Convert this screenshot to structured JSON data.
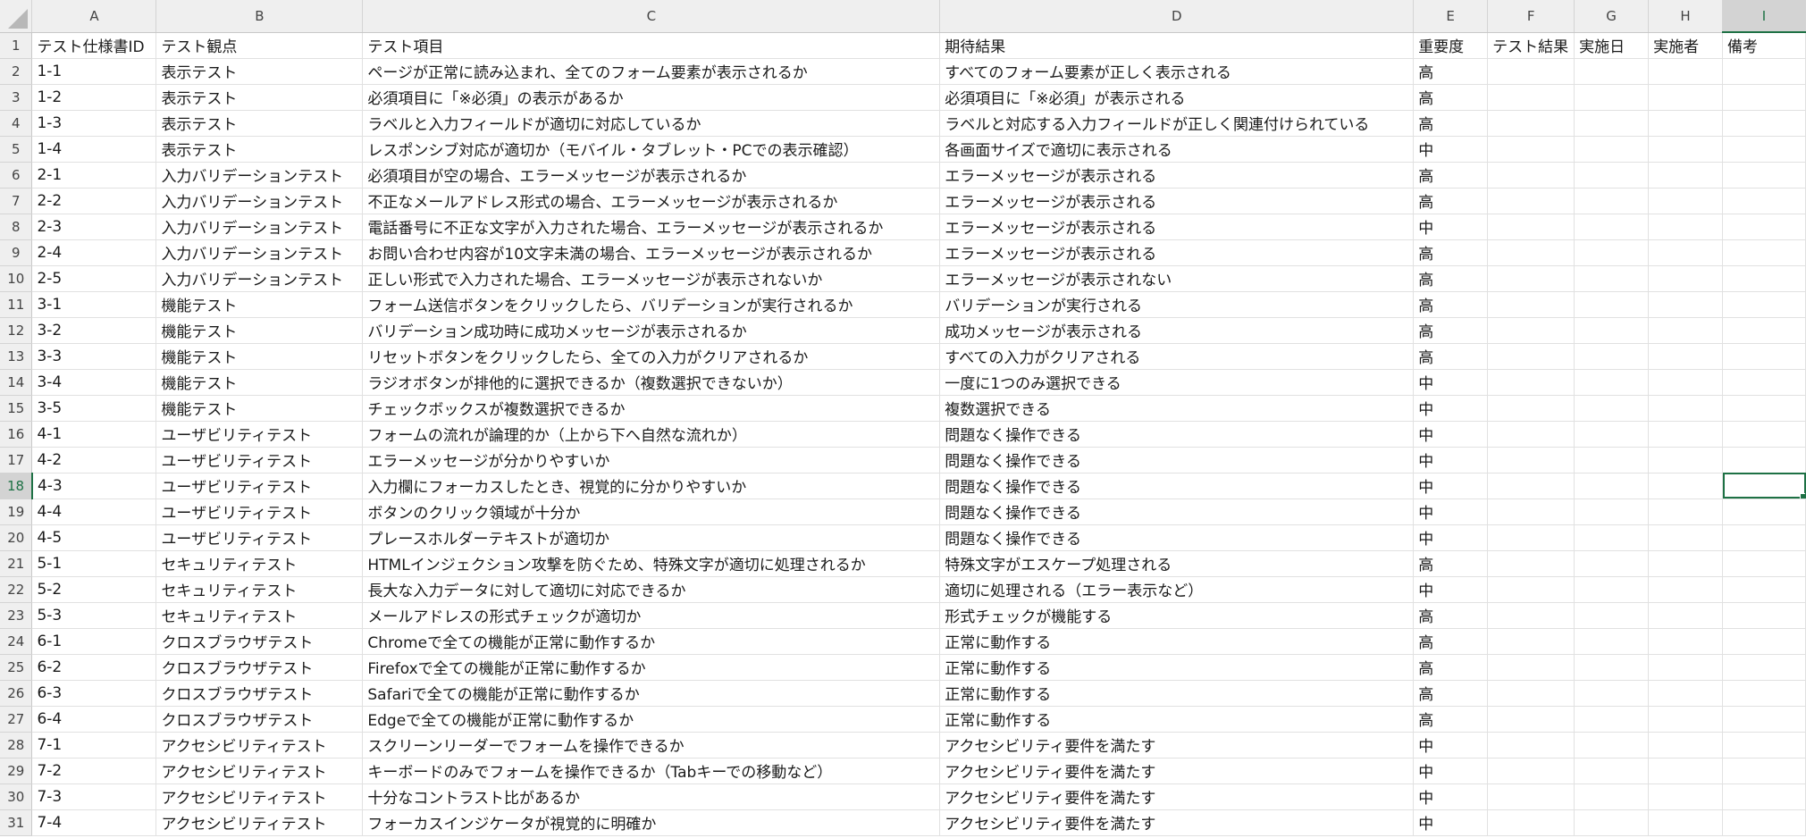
{
  "columns": [
    "A",
    "B",
    "C",
    "D",
    "E",
    "F",
    "G",
    "H",
    "I"
  ],
  "row_numbers": [
    "1",
    "2",
    "3",
    "4",
    "5",
    "6",
    "7",
    "8",
    "9",
    "10",
    "11",
    "12",
    "13",
    "14",
    "15",
    "16",
    "17",
    "18",
    "19",
    "20",
    "21",
    "22",
    "23",
    "24",
    "25",
    "26",
    "27",
    "28",
    "29",
    "30",
    "31"
  ],
  "rows": [
    [
      "テスト仕様書ID",
      "テスト観点",
      "テスト項目",
      "期待結果",
      "重要度",
      "テスト結果",
      "実施日",
      "実施者",
      "備考"
    ],
    [
      "1-1",
      "表示テスト",
      "ページが正常に読み込まれ、全てのフォーム要素が表示されるか",
      "すべてのフォーム要素が正しく表示される",
      "高",
      "",
      "",
      "",
      ""
    ],
    [
      "1-2",
      "表示テスト",
      "必須項目に「※必須」の表示があるか",
      "必須項目に「※必須」が表示される",
      "高",
      "",
      "",
      "",
      ""
    ],
    [
      "1-3",
      "表示テスト",
      "ラベルと入力フィールドが適切に対応しているか",
      "ラベルと対応する入力フィールドが正しく関連付けられている",
      "高",
      "",
      "",
      "",
      ""
    ],
    [
      "1-4",
      "表示テスト",
      "レスポンシブ対応が適切か（モバイル・タブレット・PCでの表示確認）",
      "各画面サイズで適切に表示される",
      "中",
      "",
      "",
      "",
      ""
    ],
    [
      "2-1",
      "入力バリデーションテスト",
      "必須項目が空の場合、エラーメッセージが表示されるか",
      "エラーメッセージが表示される",
      "高",
      "",
      "",
      "",
      ""
    ],
    [
      "2-2",
      "入力バリデーションテスト",
      "不正なメールアドレス形式の場合、エラーメッセージが表示されるか",
      "エラーメッセージが表示される",
      "高",
      "",
      "",
      "",
      ""
    ],
    [
      "2-3",
      "入力バリデーションテスト",
      "電話番号に不正な文字が入力された場合、エラーメッセージが表示されるか",
      "エラーメッセージが表示される",
      "中",
      "",
      "",
      "",
      ""
    ],
    [
      "2-4",
      "入力バリデーションテスト",
      "お問い合わせ内容が10文字未満の場合、エラーメッセージが表示されるか",
      "エラーメッセージが表示される",
      "高",
      "",
      "",
      "",
      ""
    ],
    [
      "2-5",
      "入力バリデーションテスト",
      "正しい形式で入力された場合、エラーメッセージが表示されないか",
      "エラーメッセージが表示されない",
      "高",
      "",
      "",
      "",
      ""
    ],
    [
      "3-1",
      "機能テスト",
      "フォーム送信ボタンをクリックしたら、バリデーションが実行されるか",
      "バリデーションが実行される",
      "高",
      "",
      "",
      "",
      ""
    ],
    [
      "3-2",
      "機能テスト",
      "バリデーション成功時に成功メッセージが表示されるか",
      "成功メッセージが表示される",
      "高",
      "",
      "",
      "",
      ""
    ],
    [
      "3-3",
      "機能テスト",
      "リセットボタンをクリックしたら、全ての入力がクリアされるか",
      "すべての入力がクリアされる",
      "高",
      "",
      "",
      "",
      ""
    ],
    [
      "3-4",
      "機能テスト",
      "ラジオボタンが排他的に選択できるか（複数選択できないか）",
      "一度に1つのみ選択できる",
      "中",
      "",
      "",
      "",
      ""
    ],
    [
      "3-5",
      "機能テスト",
      "チェックボックスが複数選択できるか",
      "複数選択できる",
      "中",
      "",
      "",
      "",
      ""
    ],
    [
      "4-1",
      "ユーザビリティテスト",
      "フォームの流れが論理的か（上から下へ自然な流れか）",
      "問題なく操作できる",
      "中",
      "",
      "",
      "",
      ""
    ],
    [
      "4-2",
      "ユーザビリティテスト",
      "エラーメッセージが分かりやすいか",
      "問題なく操作できる",
      "中",
      "",
      "",
      "",
      ""
    ],
    [
      "4-3",
      "ユーザビリティテスト",
      "入力欄にフォーカスしたとき、視覚的に分かりやすいか",
      "問題なく操作できる",
      "中",
      "",
      "",
      "",
      ""
    ],
    [
      "4-4",
      "ユーザビリティテスト",
      "ボタンのクリック領域が十分か",
      "問題なく操作できる",
      "中",
      "",
      "",
      "",
      ""
    ],
    [
      "4-5",
      "ユーザビリティテスト",
      "プレースホルダーテキストが適切か",
      "問題なく操作できる",
      "中",
      "",
      "",
      "",
      ""
    ],
    [
      "5-1",
      "セキュリティテスト",
      "HTMLインジェクション攻撃を防ぐため、特殊文字が適切に処理されるか",
      "特殊文字がエスケープ処理される",
      "高",
      "",
      "",
      "",
      ""
    ],
    [
      "5-2",
      "セキュリティテスト",
      "長大な入力データに対して適切に対応できるか",
      "適切に処理される（エラー表示など）",
      "中",
      "",
      "",
      "",
      ""
    ],
    [
      "5-3",
      "セキュリティテスト",
      "メールアドレスの形式チェックが適切か",
      "形式チェックが機能する",
      "高",
      "",
      "",
      "",
      ""
    ],
    [
      "6-1",
      "クロスブラウザテスト",
      "Chromeで全ての機能が正常に動作するか",
      "正常に動作する",
      "高",
      "",
      "",
      "",
      ""
    ],
    [
      "6-2",
      "クロスブラウザテスト",
      "Firefoxで全ての機能が正常に動作するか",
      "正常に動作する",
      "高",
      "",
      "",
      "",
      ""
    ],
    [
      "6-3",
      "クロスブラウザテスト",
      "Safariで全ての機能が正常に動作するか",
      "正常に動作する",
      "高",
      "",
      "",
      "",
      ""
    ],
    [
      "6-4",
      "クロスブラウザテスト",
      "Edgeで全ての機能が正常に動作するか",
      "正常に動作する",
      "高",
      "",
      "",
      "",
      ""
    ],
    [
      "7-1",
      "アクセシビリティテスト",
      "スクリーンリーダーでフォームを操作できるか",
      "アクセシビリティ要件を満たす",
      "中",
      "",
      "",
      "",
      ""
    ],
    [
      "7-2",
      "アクセシビリティテスト",
      "キーボードのみでフォームを操作できるか（Tabキーでの移動など）",
      "アクセシビリティ要件を満たす",
      "中",
      "",
      "",
      "",
      ""
    ],
    [
      "7-3",
      "アクセシビリティテスト",
      "十分なコントラスト比があるか",
      "アクセシビリティ要件を満たす",
      "中",
      "",
      "",
      "",
      ""
    ],
    [
      "7-4",
      "アクセシビリティテスト",
      "フォーカスインジケータが視覚的に明確か",
      "アクセシビリティ要件を満たす",
      "中",
      "",
      "",
      "",
      ""
    ]
  ],
  "selection": {
    "cell": "I18"
  },
  "colors": {
    "accent": "#1e7145",
    "header_bg": "#efefef",
    "active_header_bg": "#d3d3d3",
    "grid_line": "#e1e1e1"
  }
}
